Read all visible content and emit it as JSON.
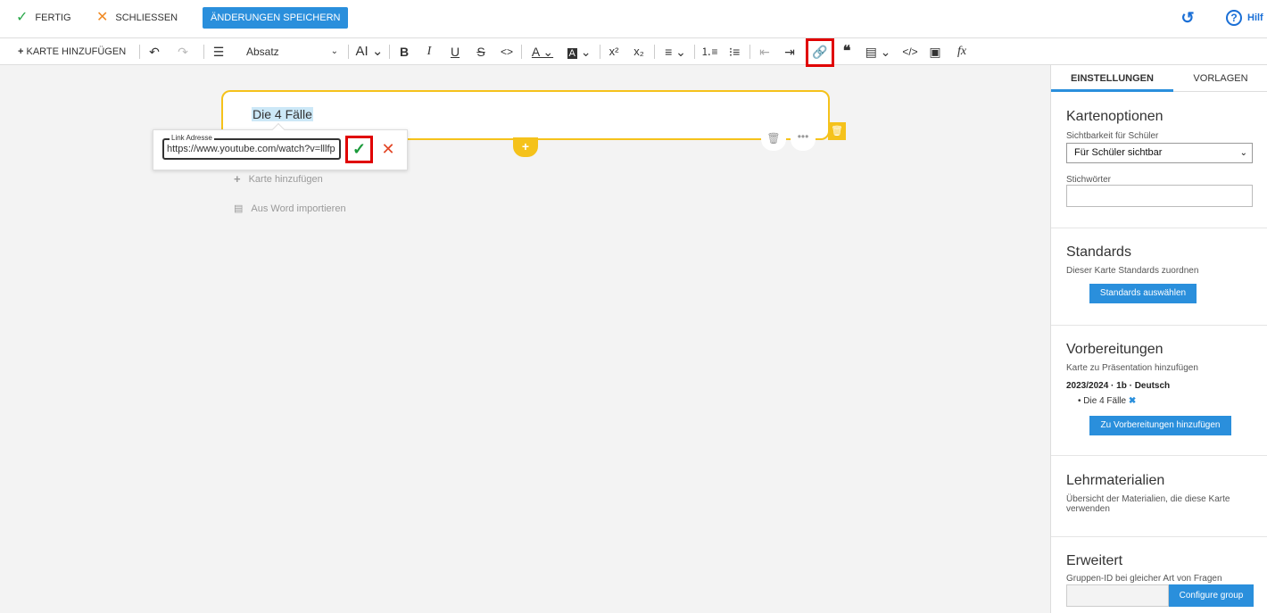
{
  "topbar": {
    "done_label": "FERTIG",
    "close_label": "SCHLIESSEN",
    "save_label": "ÄNDERUNGEN SPEICHERN",
    "help_label": "Hilf",
    "colors": {
      "accent": "#2a8fdc",
      "done": "#2aa84a",
      "close": "#f08a24"
    }
  },
  "toolbar": {
    "add_card_label": "KARTE HINZUFÜGEN",
    "format_value": "Absatz",
    "icons": [
      "undo-icon",
      "redo-icon",
      "database-icon",
      "font-size-icon",
      "bold-icon",
      "italic-icon",
      "underline-icon",
      "strikethrough-icon",
      "code-inline-icon",
      "font-color-icon",
      "highlight-color-icon",
      "superscript-icon",
      "subscript-icon",
      "align-icon",
      "ordered-list-icon",
      "bullet-list-icon",
      "outdent-icon",
      "indent-icon",
      "link-icon",
      "quote-icon",
      "template-icon",
      "code-block-icon",
      "image-icon",
      "formula-icon"
    ]
  },
  "editor": {
    "card_title": "Die 4 Fälle",
    "add_card_text": "Karte hinzufügen",
    "import_word_text": "Aus Word importieren"
  },
  "link_popup": {
    "label": "Link Adresse",
    "value": "https://www.youtube.com/watch?v=lllfp"
  },
  "panel": {
    "tabs": [
      "EINSTELLUNGEN",
      "VORLAGEN"
    ],
    "card_options": {
      "title": "Kartenoptionen",
      "visibility_label": "Sichtbarkeit für Schüler",
      "visibility_value": "Für Schüler sichtbar",
      "keywords_label": "Stichwörter"
    },
    "standards": {
      "title": "Standards",
      "desc": "Dieser Karte Standards zuordnen",
      "button": "Standards auswählen"
    },
    "preparations": {
      "title": "Vorbereitungen",
      "desc": "Karte zu Präsentation hinzufügen",
      "class_line": "2023/2024 · 1b · Deutsch",
      "item": "Die 4 Fälle",
      "remove_glyph": "✖",
      "button": "Zu Vorbereitungen hinzufügen"
    },
    "materials": {
      "title": "Lehrmaterialien",
      "desc": "Übersicht der Materialien, die diese Karte verwenden"
    },
    "advanced": {
      "title": "Erweitert",
      "desc": "Gruppen-ID bei gleicher Art von Fragen",
      "button": "Configure group"
    }
  }
}
